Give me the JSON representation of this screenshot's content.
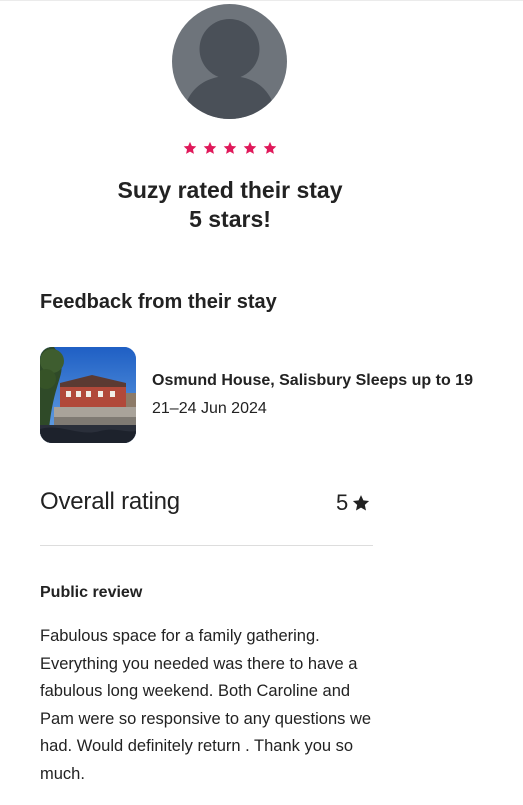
{
  "profile": {
    "avatar_icon": "default-user-avatar",
    "rating_stars": 5,
    "star_color": "#e0195a",
    "rated_line1": "Suzy rated their stay",
    "rated_line2": "5 stars!"
  },
  "feedback": {
    "section_title": "Feedback from their stay",
    "listing": {
      "name": "Osmund House, Salisbury Sleeps up to 19",
      "dates": "21–24 Jun 2024",
      "thumbnail_icon": "listing-photo"
    },
    "overall": {
      "label": "Overall rating",
      "value": "5",
      "icon": "star-icon"
    },
    "public_review": {
      "label": "Public review",
      "text": "Fabulous space for a family gathering. Everything you needed was there to have a fabulous long weekend. Both Caroline and Pam were so responsive to any questions we had. Would definitely return . Thank you so much."
    }
  }
}
